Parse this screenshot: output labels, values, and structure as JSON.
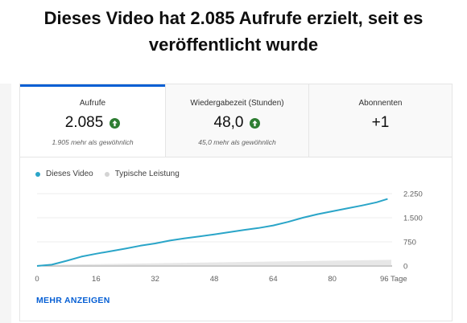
{
  "title": "Dieses Video hat 2.085 Aufrufe erzielt, seit es veröffentlicht wurde",
  "tabs": [
    {
      "label": "Aufrufe",
      "value": "2.085",
      "subtitle": "1.905 mehr als gewöhnlich",
      "trend": "up",
      "active": true
    },
    {
      "label": "Wiedergabezeit (Stunden)",
      "value": "48,0",
      "subtitle": "45,0 mehr als gewöhnlich",
      "trend": "up",
      "active": false
    },
    {
      "label": "Abonnenten",
      "value": "+1",
      "subtitle": "",
      "trend": "",
      "active": false
    }
  ],
  "legend": [
    {
      "label": "Dieses Video",
      "color": "#2aa5c8"
    },
    {
      "label": "Typische Leistung",
      "color": "#d4d4d4"
    }
  ],
  "chart_data": {
    "type": "line",
    "x_ticks": [
      "0",
      "16",
      "32",
      "48",
      "64",
      "80",
      "96 Tage"
    ],
    "x_tick_values": [
      0,
      16,
      32,
      48,
      64,
      80,
      96
    ],
    "y_ticks": [
      "2.250",
      "1.500",
      "750",
      "0"
    ],
    "y_tick_values": [
      2250,
      1500,
      750,
      0
    ],
    "xlim": [
      0,
      96
    ],
    "ylim": [
      0,
      2250
    ],
    "series": [
      {
        "name": "Dieses Video",
        "color": "#2aa5c8",
        "x": [
          0,
          4,
          8,
          12,
          16,
          20,
          24,
          28,
          32,
          36,
          40,
          44,
          48,
          52,
          56,
          60,
          64,
          68,
          72,
          76,
          80,
          84,
          88,
          92,
          95
        ],
        "y": [
          0,
          40,
          160,
          290,
          380,
          460,
          540,
          630,
          700,
          790,
          860,
          920,
          980,
          1050,
          1120,
          1180,
          1260,
          1370,
          1500,
          1610,
          1700,
          1790,
          1880,
          1980,
          2085
        ]
      },
      {
        "name": "Typische Leistung",
        "color": "#d4d4d4",
        "band": true,
        "x": [
          0,
          96
        ],
        "y_low": [
          0,
          0
        ],
        "y_high": [
          30,
          190
        ]
      }
    ]
  },
  "show_more": "MEHR ANZEIGEN"
}
